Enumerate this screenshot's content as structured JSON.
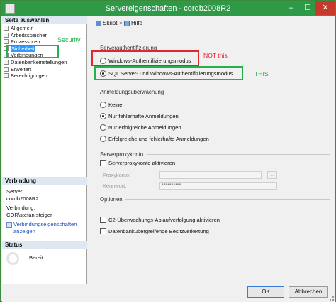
{
  "window": {
    "title": "Servereigenschaften - cordb2008R2",
    "minimize": "–",
    "maximize": "☐",
    "close": "✕"
  },
  "sidebar": {
    "header_pages": "Seite auswählen",
    "items": [
      {
        "label": "Allgemein"
      },
      {
        "label": "Arbeitsspeicher"
      },
      {
        "label": "Prozessoren"
      },
      {
        "label": "Sicherheit",
        "selected": true
      },
      {
        "label": "Verbindungen"
      },
      {
        "label": "Datenbankeinstellungen"
      },
      {
        "label": "Erweitert"
      },
      {
        "label": "Berechtigungen"
      }
    ],
    "security_note": "Security",
    "header_connection": "Verbindung",
    "server_label": "Server:",
    "server_value": "cordb2008R2",
    "connection_label": "Verbindung:",
    "connection_value": "COR\\stefan.steiger",
    "connection_link": "Verbindungseigenschaften anzeigen",
    "header_status": "Status",
    "status_value": "Bereit"
  },
  "toolbar": {
    "script_label": "Skript",
    "help_label": "Hilfe"
  },
  "auth": {
    "group_title": "Serverauthentifizierung",
    "options": [
      {
        "label": "Windows-Authentifizierungsmodus",
        "selected": false
      },
      {
        "label": "SQL Server- und Windows-Authentifizierungsmodus",
        "selected": true
      }
    ],
    "note_not": "NOT this",
    "note_this": "THIS"
  },
  "audit": {
    "group_title": "Anmeldungsüberwachung",
    "options": [
      {
        "label": "Keine",
        "selected": false
      },
      {
        "label": "Nur fehlerhafte Anmeldungen",
        "selected": true
      },
      {
        "label": "Nur erfolgreiche Anmeldungen",
        "selected": false
      },
      {
        "label": "Erfolgreiche und fehlerhafte Anmeldungen",
        "selected": false
      }
    ]
  },
  "proxy": {
    "group_title": "Serverproxykonto",
    "enable_label": "Serverproxykonto aktivieren",
    "account_label": "Proxykonto:",
    "account_value": "",
    "password_label": "Kennwort:",
    "password_value": "**********",
    "browse_label": "..."
  },
  "options": {
    "group_title": "Optionen",
    "c2_label": "C2-Überwachungs-Ablaufverfolgung aktivieren",
    "chain_label": "Datenbankübergreifende Besitzverkettung"
  },
  "footer": {
    "ok_label": "OK",
    "cancel_label": "Abbrechen"
  },
  "colors": {
    "titlebar": "#2e9a48",
    "selection": "#3399ff",
    "annotation_red": "#e0262e",
    "annotation_green": "#22b14c"
  }
}
